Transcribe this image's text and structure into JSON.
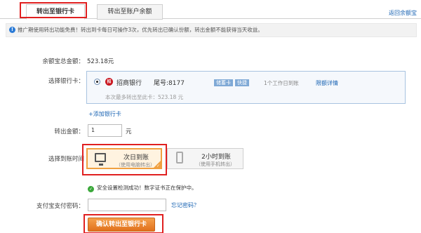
{
  "tabs": {
    "active": "转出至银行卡",
    "inactive": "转出至账户余额",
    "back_link": "返回余额宝"
  },
  "notice": {
    "icon": "!",
    "text": "推广期使用转出功能免费！转出到卡每日可操作3次，优先转出已确认份额，转出金额不能获得当天收益。"
  },
  "balance": {
    "label": "余额宝总金额：",
    "value": "523.18元"
  },
  "bank_select": {
    "label": "选择银行卡：",
    "logo_text": "招",
    "bank_name": "招商银行",
    "tail": "尾号:8177",
    "tag_debit": "储蓄卡",
    "tag_fast": "快捷",
    "arrival": "1个工作日到账",
    "limit_link": "限额详情",
    "max_note": "本次最多转出至此卡：523.18 元"
  },
  "add_card": "+添加银行卡",
  "amount": {
    "label": "转出金额：",
    "value": "1",
    "unit": "元"
  },
  "arrival_time": {
    "label": "选择到账时间",
    "options": [
      {
        "main": "次日到账",
        "sub": "（使用电脑转出）"
      },
      {
        "main": "2小时到账",
        "sub": "（使用手机转出）"
      }
    ]
  },
  "security": {
    "text": "安全设置检测成功！数字证书正在保护中。"
  },
  "password": {
    "label": "支付宝支付密码：",
    "forgot": "忘记密码？"
  },
  "submit": {
    "label": "确认转出至银行卡"
  },
  "colors": {
    "link": "#1a64b3",
    "highlight": "#e02020",
    "accent": "#f0a040"
  },
  "icons": [
    "info-icon",
    "bank-logo-icon",
    "monitor-icon",
    "phone-icon",
    "shield-check-icon"
  ]
}
